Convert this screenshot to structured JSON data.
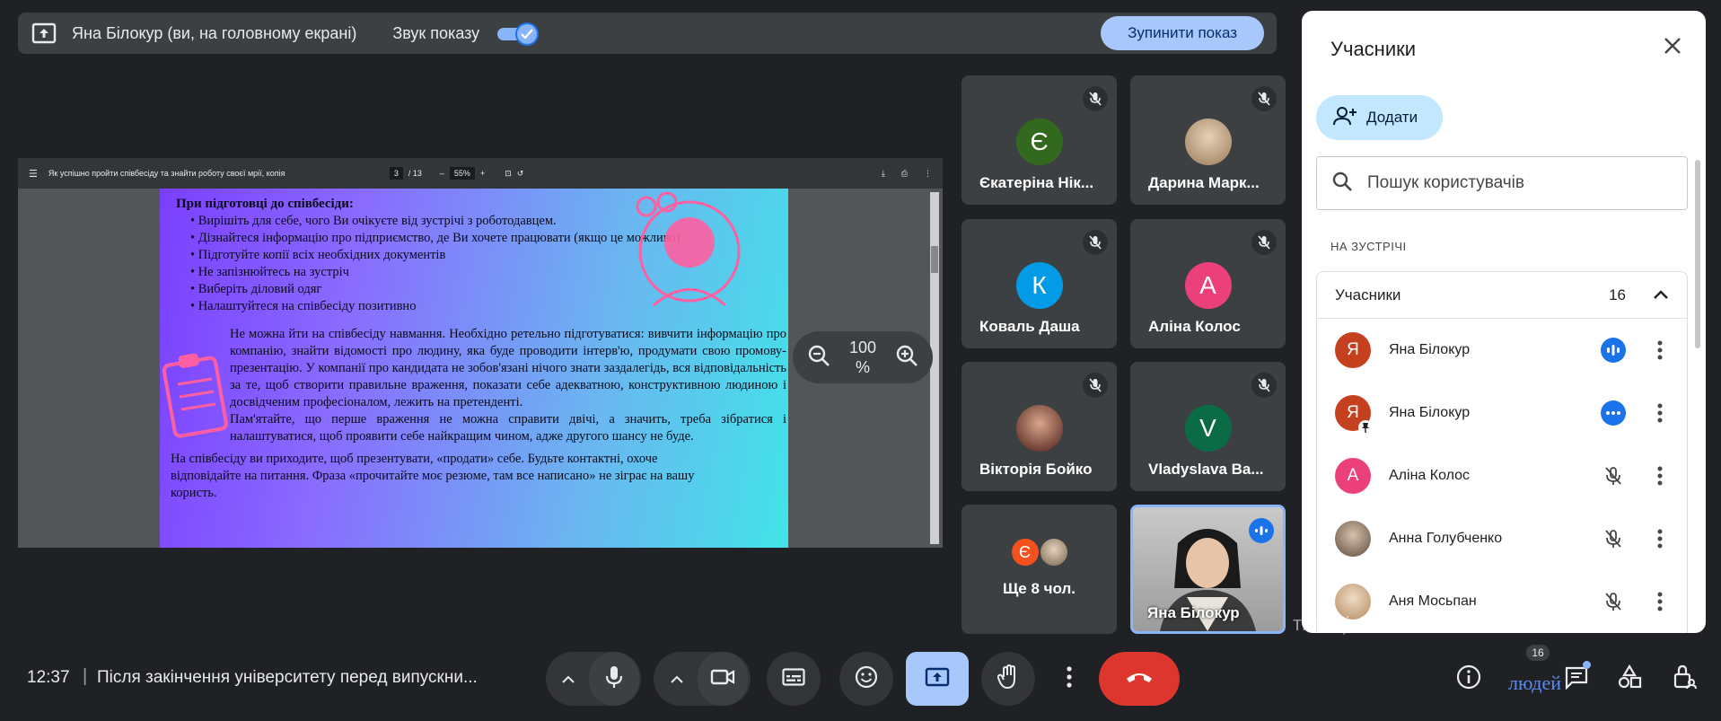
{
  "present_bar": {
    "presenter_text": "Яна Білокур (ви, на головному екрані)",
    "sound_label": "Звук показу",
    "stop_label": "Зупинити показ"
  },
  "pdf": {
    "title": "Як успішно пройти співбесіду та знайти роботу своєї мрії, копія",
    "page_current": "3",
    "page_total": "/ 13",
    "zoom": "55%",
    "heading": "При підготовці до співбесіди:",
    "bullets": [
      "Вирішіть для себе, чого Ви очікуєте від зустрічі з роботодавцем.",
      "Дізнайтеся інформацію про підприємство, де Ви хочете працювати (якщо це можливо)",
      "Підготуйте копії всіх необхідних документів",
      "Не запізнюйтесь на зустріч",
      "Виберіть діловий одяг",
      "Налаштуйтеся на співбесіду позитивно"
    ],
    "para1": "Не можна йти на співбесіду навмання. Необхідно ретельно підготуватися: вивчити інформацію про компанію, знайти відомості про людину, яка буде проводити інтерв'ю, продумати свою промову-презентацію. У компанії про кандидата не зобов'язані нічого знати заздалегідь, вся відповідальність за те, щоб створити правильне враження, показати себе адекватною, конструктивною людиною і досвідченим професіоналом, лежить на претенденті.",
    "para2": "Пам'ятайте, що перше враження не можна справити двічі, а значить, треба зібратися і налаштуватися, щоб проявити себе найкращим чином, адже другого шансу не буде.",
    "para3": "На співбесіду ви приходите, щоб презентувати, «продати» себе. Будьте контактні, охоче відповідайте на питання. Фраза «прочитайте моє резюме, там все написано» не зіграє на вашу користь.",
    "zoom_ctrl_value": "100 %"
  },
  "tiles": [
    {
      "name": "Єкатеріна Нік...",
      "initial": "Є",
      "color": "#33691e"
    },
    {
      "name": "Дарина Марк...",
      "initial": "",
      "color": "#b08a6a"
    },
    {
      "name": "Коваль Даша",
      "initial": "К",
      "color": "#039be5"
    },
    {
      "name": "Аліна Колос",
      "initial": "А",
      "color": "#ec407a"
    },
    {
      "name": "Вікторія Бойко",
      "initial": "",
      "color": "#5d2a22"
    },
    {
      "name": "Vladyslava Ba...",
      "initial": "V",
      "color": "#0b6b47"
    },
    {
      "name": "Ще 8 чол.",
      "initial": "Є",
      "color": "#f4511e"
    },
    {
      "name": "Яна Білокур",
      "initial": "",
      "color": "#b0b0b0"
    }
  ],
  "panel": {
    "title": "Учасники",
    "add_label": "Додати",
    "search_placeholder": "Пошук користувачів",
    "section": "НА ЗУСТРІЧІ",
    "group_title": "Учасники",
    "group_count": "16",
    "people": [
      {
        "name": "Яна Білокур",
        "initial": "Я",
        "color": "#c5401e"
      },
      {
        "name": "Яна Білокур",
        "initial": "Я",
        "color": "#c5401e"
      },
      {
        "name": "Аліна Колос",
        "initial": "А",
        "color": "#ec407a"
      },
      {
        "name": "Анна Голубченко",
        "initial": "",
        "color": "#6d5a4a"
      },
      {
        "name": "Аня Мосьпан",
        "initial": "",
        "color": "#c9a27c"
      }
    ]
  },
  "bottom": {
    "time": "12:37",
    "divider": "|",
    "meeting": "Після закінчення університету перед випускни...",
    "people_badge": "16",
    "people_label": "людей"
  },
  "watermark": "тиваціяWindows",
  "colors": {
    "accent": "#8ab4f8",
    "end_call": "#dc362e",
    "present_active": "#a8c7fa"
  }
}
